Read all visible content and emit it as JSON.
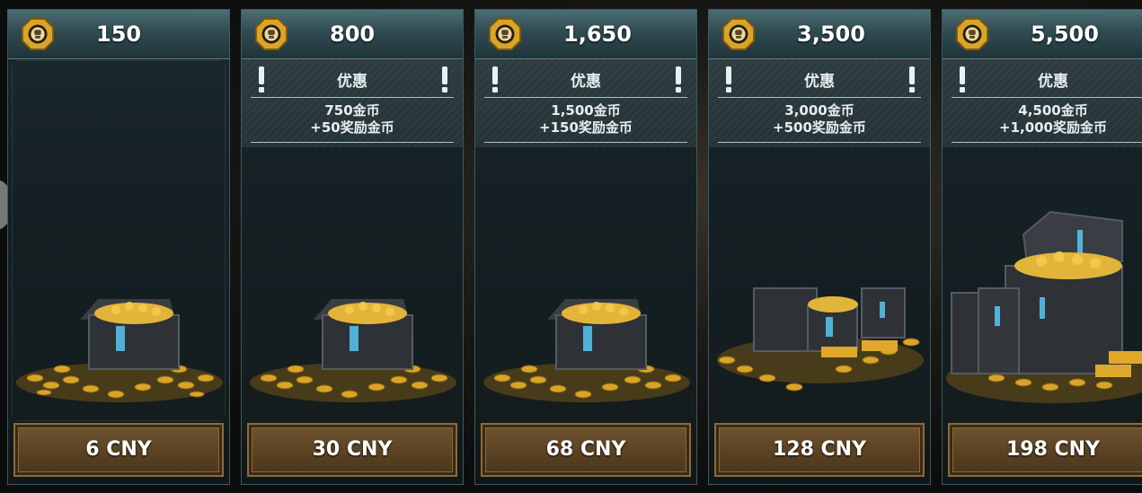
{
  "store": {
    "packs": [
      {
        "coins": "150",
        "offer": null,
        "price": "6 CNY"
      },
      {
        "coins": "800",
        "offer": {
          "title": "优惠",
          "line1": "750金币",
          "line2": "+50奖励金币"
        },
        "price": "30 CNY"
      },
      {
        "coins": "1,650",
        "offer": {
          "title": "优惠",
          "line1": "1,500金币",
          "line2": "+150奖励金币"
        },
        "price": "68 CNY"
      },
      {
        "coins": "3,500",
        "offer": {
          "title": "优惠",
          "line1": "3,000金币",
          "line2": "+500奖励金币"
        },
        "price": "128 CNY"
      },
      {
        "coins": "5,500",
        "offer": {
          "title": "优惠",
          "line1": "4,500金币",
          "line2": "+1,000奖励金币"
        },
        "price": "198 CNY"
      }
    ]
  },
  "icons": {
    "coin": "gold-coin-icon",
    "alert": "exclamation-icon"
  },
  "colors": {
    "card_header": "#2f4b51",
    "price_button": "#5a4223",
    "gold": "#d9a528"
  }
}
